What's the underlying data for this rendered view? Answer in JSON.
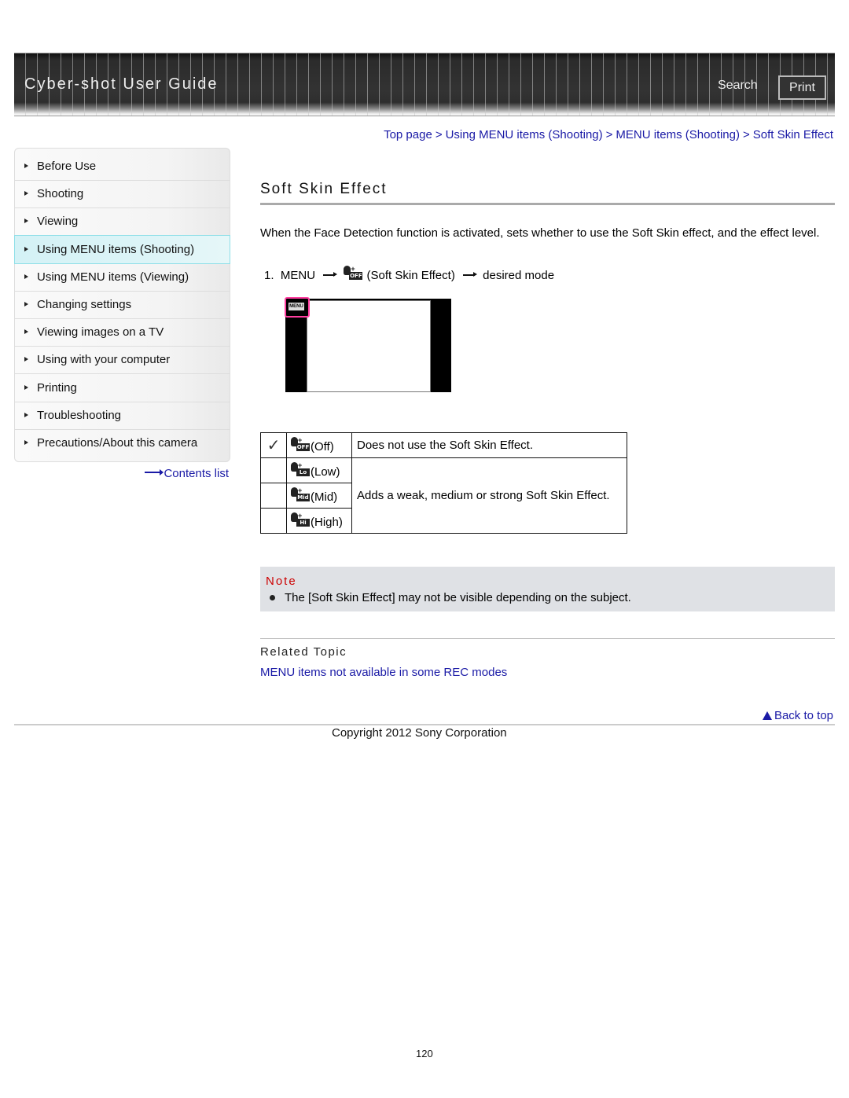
{
  "header": {
    "title": "Cyber-shot User Guide",
    "search_label": "Search",
    "print_label": "Print"
  },
  "breadcrumb": [
    {
      "label": "Top page"
    },
    {
      "label": "Using MENU items (Shooting)"
    },
    {
      "label": "MENU items (Shooting)"
    },
    {
      "label": "Soft Skin Effect"
    }
  ],
  "breadcrumb_separator": ">",
  "sidebar": {
    "items": [
      {
        "label": "Before Use"
      },
      {
        "label": "Shooting"
      },
      {
        "label": "Viewing"
      },
      {
        "label": "Using MENU items (Shooting)",
        "active": true
      },
      {
        "label": "Using MENU items (Viewing)"
      },
      {
        "label": "Changing settings"
      },
      {
        "label": "Viewing images on a TV"
      },
      {
        "label": "Using with your computer"
      },
      {
        "label": "Printing"
      },
      {
        "label": "Troubleshooting"
      },
      {
        "label": "Precautions/About this camera"
      }
    ],
    "contents_list_label": "Contents list"
  },
  "main": {
    "title": "Soft Skin Effect",
    "intro": "When the Face Detection function is activated, sets whether to use the Soft Skin effect, and the effect level.",
    "step": {
      "number": "1.",
      "menu": "MENU",
      "icon_tag": "OFF",
      "item": "(Soft Skin Effect)",
      "target": "desired mode"
    },
    "screen_menu_label": "MENU",
    "options": [
      {
        "default": true,
        "icon_tag": "OFF",
        "label": "(Off)",
        "description": "Does not use the Soft Skin Effect."
      },
      {
        "default": false,
        "icon_tag": "Lo",
        "label": "(Low)",
        "description": "Adds a weak, medium or strong Soft Skin Effect."
      },
      {
        "default": false,
        "icon_tag": "Mid",
        "label": "(Mid)"
      },
      {
        "default": false,
        "icon_tag": "Hi",
        "label": "(High)"
      }
    ],
    "check_glyph": "✓",
    "note": {
      "title": "Note",
      "items": [
        "The [Soft Skin Effect] may not be visible depending on the subject."
      ]
    },
    "related": {
      "title": "Related Topic",
      "links": [
        "MENU items not available in some REC modes"
      ]
    }
  },
  "footer": {
    "back_to_top": "Back to top",
    "copyright": "Copyright 2012 Sony Corporation",
    "page_number": "120"
  },
  "colors": {
    "link": "#1a1aa6",
    "note_title": "#cc0000",
    "note_bg": "#dfe1e5",
    "active_nav_bg": "#d4f2f6",
    "screen_highlight": "#ff3ea0"
  }
}
